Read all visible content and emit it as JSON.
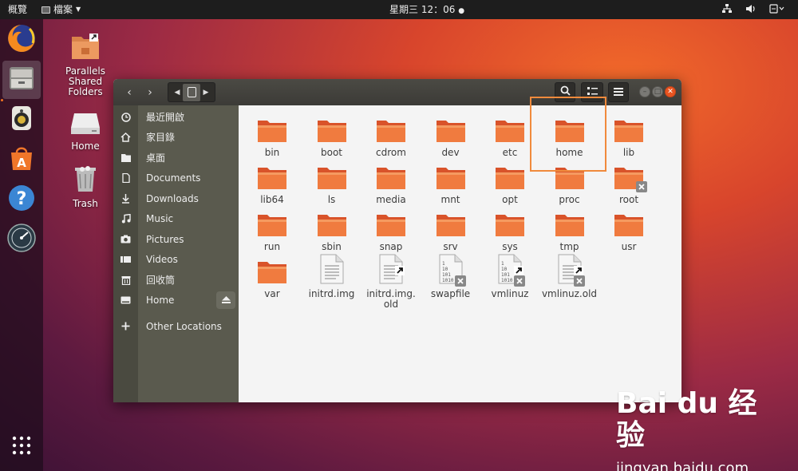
{
  "topbar": {
    "activities": "概覽",
    "app_menu": "檔案",
    "clock": "星期三 12：06"
  },
  "dock": {
    "items": [
      "firefox-icon",
      "files-icon",
      "rhythmbox-icon",
      "software-icon",
      "help-icon",
      "update-icon"
    ],
    "show_apps": "apps-grid-icon"
  },
  "desktop": {
    "icons": [
      {
        "label": "Parallels\nShared\nFolders"
      },
      {
        "label": "Home"
      },
      {
        "label": "Trash"
      }
    ]
  },
  "window": {
    "sidebar": [
      {
        "label": "最近開啟",
        "icon": "clock-icon"
      },
      {
        "label": "家目錄",
        "icon": "home-icon"
      },
      {
        "label": "桌面",
        "icon": "folder-icon"
      },
      {
        "label": "Documents",
        "icon": "document-icon"
      },
      {
        "label": "Downloads",
        "icon": "download-icon"
      },
      {
        "label": "Music",
        "icon": "music-icon"
      },
      {
        "label": "Pictures",
        "icon": "camera-icon"
      },
      {
        "label": "Videos",
        "icon": "video-icon"
      },
      {
        "label": "回收筒",
        "icon": "trash-icon"
      },
      {
        "label": "Home",
        "icon": "drive-icon"
      },
      {
        "label": "Other Locations",
        "icon": "plus-icon"
      }
    ],
    "files": [
      {
        "name": "bin",
        "type": "folder"
      },
      {
        "name": "boot",
        "type": "folder"
      },
      {
        "name": "cdrom",
        "type": "folder"
      },
      {
        "name": "dev",
        "type": "folder"
      },
      {
        "name": "etc",
        "type": "folder"
      },
      {
        "name": "home",
        "type": "folder"
      },
      {
        "name": "lib",
        "type": "folder"
      },
      {
        "name": "lib64",
        "type": "folder"
      },
      {
        "name": "ls",
        "type": "folder"
      },
      {
        "name": "media",
        "type": "folder"
      },
      {
        "name": "mnt",
        "type": "folder"
      },
      {
        "name": "opt",
        "type": "folder"
      },
      {
        "name": "proc",
        "type": "folder"
      },
      {
        "name": "root",
        "type": "folder-locked"
      },
      {
        "name": "run",
        "type": "folder"
      },
      {
        "name": "sbin",
        "type": "folder"
      },
      {
        "name": "snap",
        "type": "folder"
      },
      {
        "name": "srv",
        "type": "folder"
      },
      {
        "name": "sys",
        "type": "folder"
      },
      {
        "name": "tmp",
        "type": "folder"
      },
      {
        "name": "usr",
        "type": "folder"
      },
      {
        "name": "var",
        "type": "folder"
      },
      {
        "name": "initrd.img",
        "type": "file"
      },
      {
        "name": "initrd.img.\nold",
        "type": "file-link"
      },
      {
        "name": "swapfile",
        "type": "binary-locked"
      },
      {
        "name": "vmlinuz",
        "type": "binary-link-locked"
      },
      {
        "name": "vmlinuz.old",
        "type": "file-link-locked"
      }
    ]
  },
  "watermark": {
    "logo": "Bai du 经验",
    "url": "jingyan.baidu.com"
  },
  "colors": {
    "accent": "#f47421",
    "folder": "#e8612c",
    "highlight": "#f08a3c"
  }
}
